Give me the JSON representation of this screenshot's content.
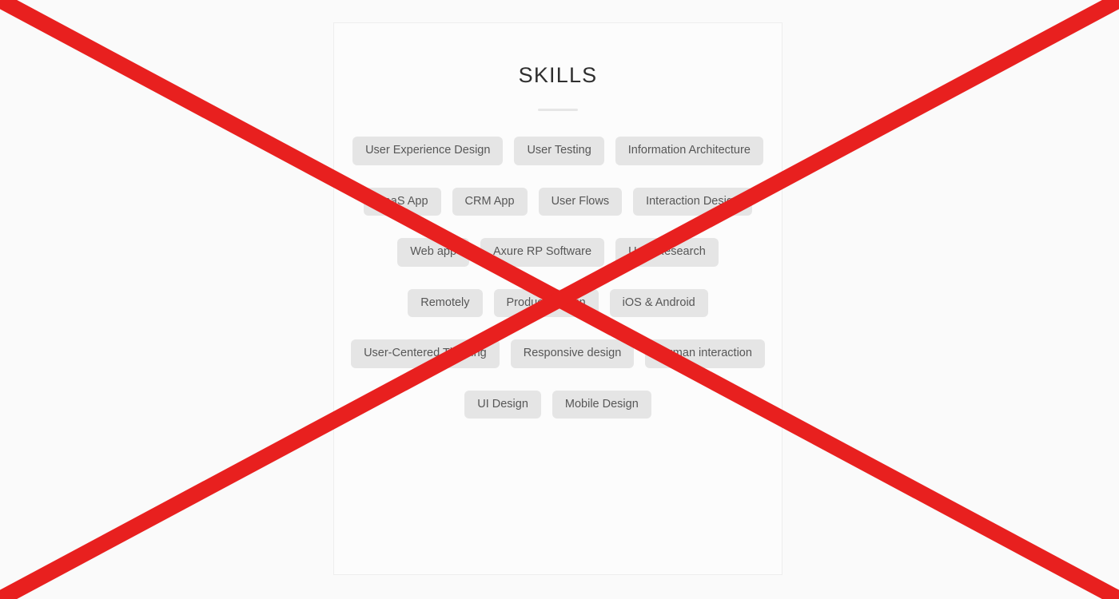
{
  "page": {
    "background_color": "#fafafa",
    "overlay": {
      "name": "red-cross-overlay",
      "color": "#e8201f",
      "stroke_width": 14
    }
  },
  "card": {
    "background_color": "#fcfcfc",
    "border_color": "#eeeeee",
    "title": "SKILLS",
    "divider_color": "#e6e6e6"
  },
  "tags": {
    "pill_color": "#e5e5e5",
    "text_color": "#575757",
    "groups": [
      {
        "name": "group-1",
        "items": [
          "User Experience Design",
          "User Testing",
          "Information Architecture"
        ]
      },
      {
        "name": "group-2",
        "items": [
          "SaaS App",
          "CRM App",
          "User Flows",
          "Interaction Design"
        ]
      },
      {
        "name": "group-3",
        "items": [
          "Web app",
          "Axure RP Software",
          "User Research"
        ]
      },
      {
        "name": "group-4",
        "items": [
          "Remotely",
          "Product Design",
          "iOS & Android"
        ]
      },
      {
        "name": "group-5",
        "items": [
          "User-Centered Thinking",
          "Responsive design",
          "Human interaction"
        ]
      },
      {
        "name": "group-6",
        "items": [
          "UI Design",
          "Mobile Design"
        ]
      }
    ]
  }
}
